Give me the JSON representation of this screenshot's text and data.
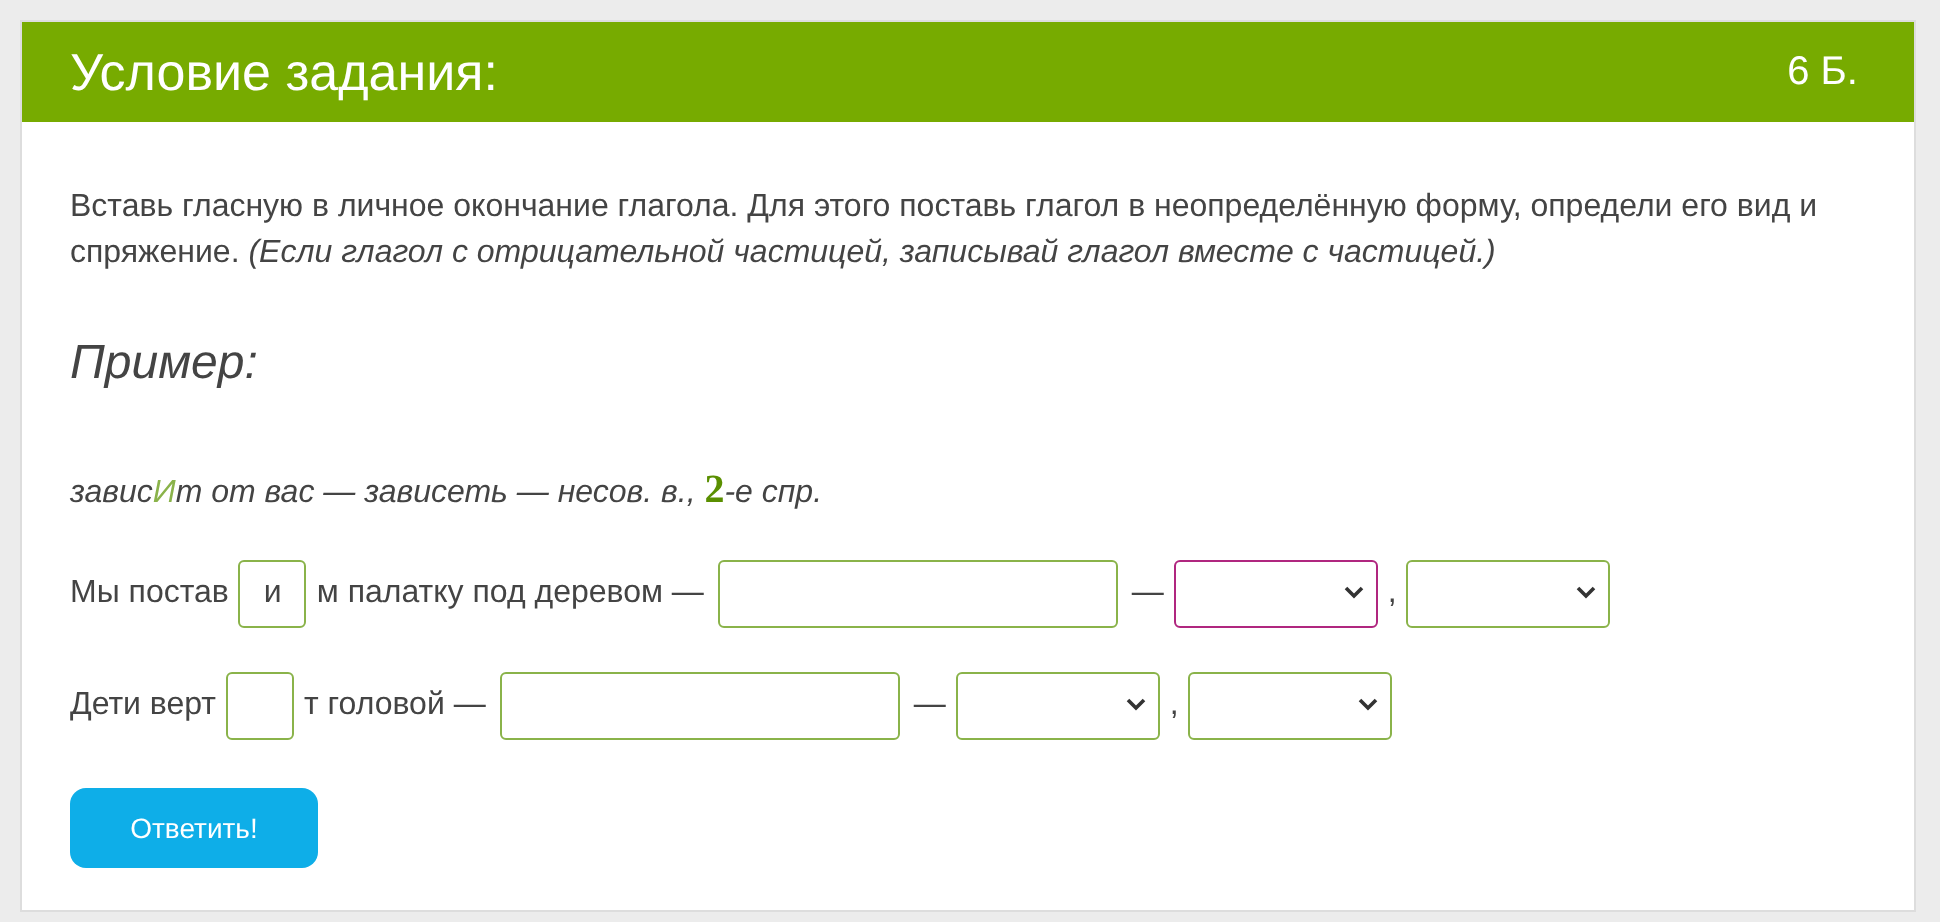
{
  "header": {
    "title": "Условие задания:",
    "points": "6 Б."
  },
  "instruction": {
    "text": "Вставь гласную в личное окончание глагола. Для этого поставь глагол в неопределённую форму, определи его вид и спряжение.",
    "note": "(Если глагол с отрицательной частицей, записывай глагол вместе с частицей.)"
  },
  "example": {
    "heading": "Пример:",
    "segments": [
      {
        "kind": "plain",
        "text": "завис"
      },
      {
        "kind": "highlight",
        "text": "И"
      },
      {
        "kind": "plain",
        "text": "т от вас — зависеть — несов. в., "
      },
      {
        "kind": "number",
        "text": "2"
      },
      {
        "kind": "plain",
        "text": "-е спр."
      }
    ]
  },
  "rows": [
    {
      "items": [
        {
          "kind": "text",
          "text": "Мы постав"
        },
        {
          "kind": "letter",
          "value": "и"
        },
        {
          "kind": "text",
          "text": "м палатку под деревом —"
        },
        {
          "kind": "field"
        },
        {
          "kind": "text",
          "text": "—"
        },
        {
          "kind": "select",
          "focused": true
        },
        {
          "kind": "text",
          "text": ","
        },
        {
          "kind": "select",
          "focused": false
        }
      ]
    },
    {
      "items": [
        {
          "kind": "text",
          "text": "Дети верт"
        },
        {
          "kind": "letter",
          "value": ""
        },
        {
          "kind": "text",
          "text": "т головой —"
        },
        {
          "kind": "field"
        },
        {
          "kind": "text",
          "text": "—"
        },
        {
          "kind": "select",
          "focused": false
        },
        {
          "kind": "text",
          "text": ","
        },
        {
          "kind": "select",
          "focused": false
        }
      ]
    }
  ],
  "submit": {
    "label": "Ответить!"
  }
}
